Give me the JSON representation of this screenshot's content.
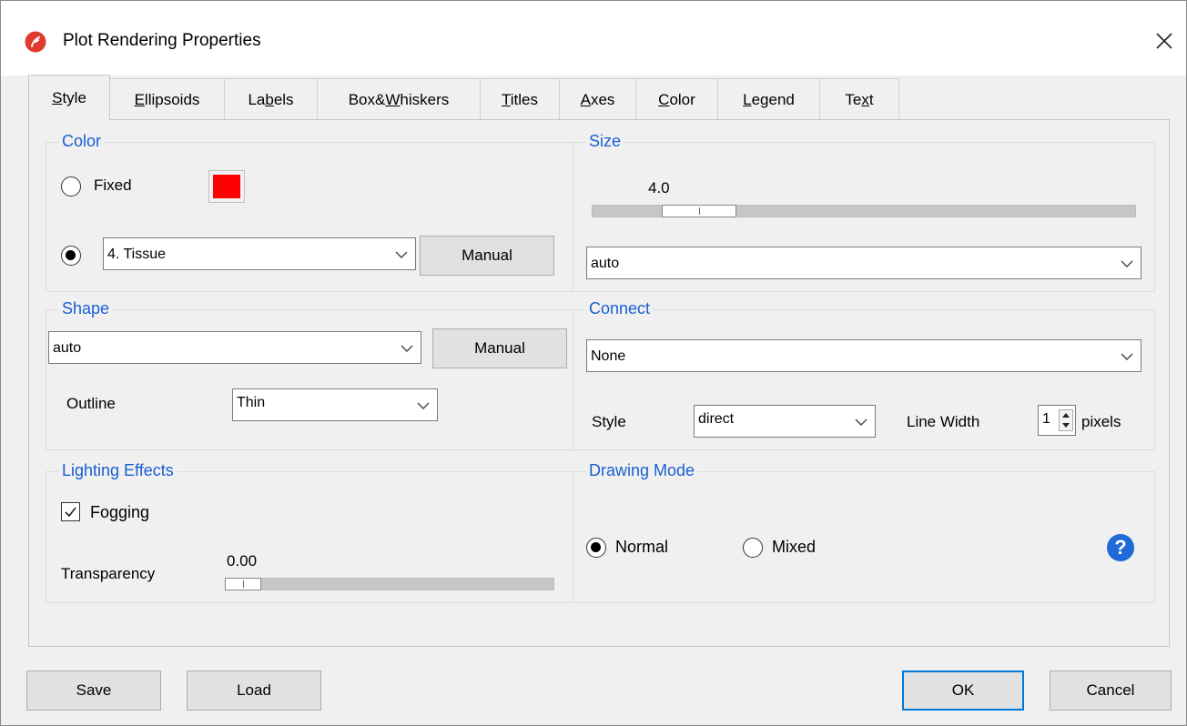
{
  "window": {
    "title": "Plot Rendering Properties",
    "app_icon": "app-logo-icon",
    "close_icon": "close-icon"
  },
  "tabs": [
    {
      "label_pre": "",
      "label_ul": "S",
      "label_post": "tyle",
      "active": true
    },
    {
      "label_pre": "",
      "label_ul": "E",
      "label_post": "llipsoids",
      "active": false
    },
    {
      "label_pre": "La",
      "label_ul": "b",
      "label_post": "els",
      "active": false
    },
    {
      "label_pre": "Box&",
      "label_ul": "W",
      "label_post": "hiskers",
      "active": false
    },
    {
      "label_pre": "",
      "label_ul": "T",
      "label_post": "itles",
      "active": false
    },
    {
      "label_pre": "",
      "label_ul": "A",
      "label_post": "xes",
      "active": false
    },
    {
      "label_pre": "",
      "label_ul": "C",
      "label_post": "olor",
      "active": false
    },
    {
      "label_pre": "",
      "label_ul": "L",
      "label_post": "egend",
      "active": false
    },
    {
      "label_pre": "Te",
      "label_ul": "x",
      "label_post": "t",
      "active": false
    }
  ],
  "color_group": {
    "title": "Color",
    "fixed_label": "Fixed",
    "fixed_selected": false,
    "swatch_color": "#ff0000",
    "variable_selected": true,
    "variable_value": "4. Tissue",
    "manual_label": "Manual"
  },
  "size_group": {
    "title": "Size",
    "slider_value_text": "4.0",
    "slider_fraction": 0.12,
    "combo_value": "auto"
  },
  "shape_group": {
    "title": "Shape",
    "combo_value": "auto",
    "manual_label": "Manual",
    "outline_label": "Outline",
    "outline_value": "Thin"
  },
  "connect_group": {
    "title": "Connect",
    "combo_value": "None",
    "style_label": "Style",
    "style_value": "direct",
    "line_width_label": "Line Width",
    "line_width_value": "1",
    "pixels_label": "pixels"
  },
  "lighting_group": {
    "title": "Lighting Effects",
    "fogging_label": "Fogging",
    "fogging_checked": true,
    "transparency_label": "Transparency",
    "transparency_value_text": "0.00",
    "transparency_fraction": 0.0
  },
  "drawing_group": {
    "title": "Drawing Mode",
    "normal_label": "Normal",
    "normal_selected": true,
    "mixed_label": "Mixed",
    "mixed_selected": false,
    "help_icon": "help-icon"
  },
  "footer": {
    "save_label": "Save",
    "load_label": "Load",
    "ok_label": "OK",
    "cancel_label": "Cancel"
  },
  "colors": {
    "group_title": "#1a5fd2",
    "default_button_border": "#0078d7",
    "help_icon_bg": "#1f6ad6"
  }
}
